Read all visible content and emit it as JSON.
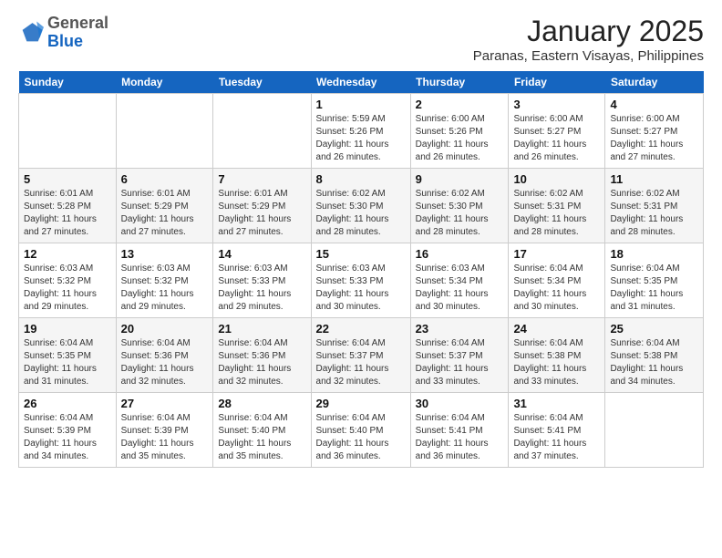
{
  "header": {
    "logo_general": "General",
    "logo_blue": "Blue",
    "month_title": "January 2025",
    "location": "Paranas, Eastern Visayas, Philippines"
  },
  "days_of_week": [
    "Sunday",
    "Monday",
    "Tuesday",
    "Wednesday",
    "Thursday",
    "Friday",
    "Saturday"
  ],
  "weeks": [
    [
      {
        "day": "",
        "info": ""
      },
      {
        "day": "",
        "info": ""
      },
      {
        "day": "",
        "info": ""
      },
      {
        "day": "1",
        "info": "Sunrise: 5:59 AM\nSunset: 5:26 PM\nDaylight: 11 hours\nand 26 minutes."
      },
      {
        "day": "2",
        "info": "Sunrise: 6:00 AM\nSunset: 5:26 PM\nDaylight: 11 hours\nand 26 minutes."
      },
      {
        "day": "3",
        "info": "Sunrise: 6:00 AM\nSunset: 5:27 PM\nDaylight: 11 hours\nand 26 minutes."
      },
      {
        "day": "4",
        "info": "Sunrise: 6:00 AM\nSunset: 5:27 PM\nDaylight: 11 hours\nand 27 minutes."
      }
    ],
    [
      {
        "day": "5",
        "info": "Sunrise: 6:01 AM\nSunset: 5:28 PM\nDaylight: 11 hours\nand 27 minutes."
      },
      {
        "day": "6",
        "info": "Sunrise: 6:01 AM\nSunset: 5:29 PM\nDaylight: 11 hours\nand 27 minutes."
      },
      {
        "day": "7",
        "info": "Sunrise: 6:01 AM\nSunset: 5:29 PM\nDaylight: 11 hours\nand 27 minutes."
      },
      {
        "day": "8",
        "info": "Sunrise: 6:02 AM\nSunset: 5:30 PM\nDaylight: 11 hours\nand 28 minutes."
      },
      {
        "day": "9",
        "info": "Sunrise: 6:02 AM\nSunset: 5:30 PM\nDaylight: 11 hours\nand 28 minutes."
      },
      {
        "day": "10",
        "info": "Sunrise: 6:02 AM\nSunset: 5:31 PM\nDaylight: 11 hours\nand 28 minutes."
      },
      {
        "day": "11",
        "info": "Sunrise: 6:02 AM\nSunset: 5:31 PM\nDaylight: 11 hours\nand 28 minutes."
      }
    ],
    [
      {
        "day": "12",
        "info": "Sunrise: 6:03 AM\nSunset: 5:32 PM\nDaylight: 11 hours\nand 29 minutes."
      },
      {
        "day": "13",
        "info": "Sunrise: 6:03 AM\nSunset: 5:32 PM\nDaylight: 11 hours\nand 29 minutes."
      },
      {
        "day": "14",
        "info": "Sunrise: 6:03 AM\nSunset: 5:33 PM\nDaylight: 11 hours\nand 29 minutes."
      },
      {
        "day": "15",
        "info": "Sunrise: 6:03 AM\nSunset: 5:33 PM\nDaylight: 11 hours\nand 30 minutes."
      },
      {
        "day": "16",
        "info": "Sunrise: 6:03 AM\nSunset: 5:34 PM\nDaylight: 11 hours\nand 30 minutes."
      },
      {
        "day": "17",
        "info": "Sunrise: 6:04 AM\nSunset: 5:34 PM\nDaylight: 11 hours\nand 30 minutes."
      },
      {
        "day": "18",
        "info": "Sunrise: 6:04 AM\nSunset: 5:35 PM\nDaylight: 11 hours\nand 31 minutes."
      }
    ],
    [
      {
        "day": "19",
        "info": "Sunrise: 6:04 AM\nSunset: 5:35 PM\nDaylight: 11 hours\nand 31 minutes."
      },
      {
        "day": "20",
        "info": "Sunrise: 6:04 AM\nSunset: 5:36 PM\nDaylight: 11 hours\nand 32 minutes."
      },
      {
        "day": "21",
        "info": "Sunrise: 6:04 AM\nSunset: 5:36 PM\nDaylight: 11 hours\nand 32 minutes."
      },
      {
        "day": "22",
        "info": "Sunrise: 6:04 AM\nSunset: 5:37 PM\nDaylight: 11 hours\nand 32 minutes."
      },
      {
        "day": "23",
        "info": "Sunrise: 6:04 AM\nSunset: 5:37 PM\nDaylight: 11 hours\nand 33 minutes."
      },
      {
        "day": "24",
        "info": "Sunrise: 6:04 AM\nSunset: 5:38 PM\nDaylight: 11 hours\nand 33 minutes."
      },
      {
        "day": "25",
        "info": "Sunrise: 6:04 AM\nSunset: 5:38 PM\nDaylight: 11 hours\nand 34 minutes."
      }
    ],
    [
      {
        "day": "26",
        "info": "Sunrise: 6:04 AM\nSunset: 5:39 PM\nDaylight: 11 hours\nand 34 minutes."
      },
      {
        "day": "27",
        "info": "Sunrise: 6:04 AM\nSunset: 5:39 PM\nDaylight: 11 hours\nand 35 minutes."
      },
      {
        "day": "28",
        "info": "Sunrise: 6:04 AM\nSunset: 5:40 PM\nDaylight: 11 hours\nand 35 minutes."
      },
      {
        "day": "29",
        "info": "Sunrise: 6:04 AM\nSunset: 5:40 PM\nDaylight: 11 hours\nand 36 minutes."
      },
      {
        "day": "30",
        "info": "Sunrise: 6:04 AM\nSunset: 5:41 PM\nDaylight: 11 hours\nand 36 minutes."
      },
      {
        "day": "31",
        "info": "Sunrise: 6:04 AM\nSunset: 5:41 PM\nDaylight: 11 hours\nand 37 minutes."
      },
      {
        "day": "",
        "info": ""
      }
    ]
  ]
}
